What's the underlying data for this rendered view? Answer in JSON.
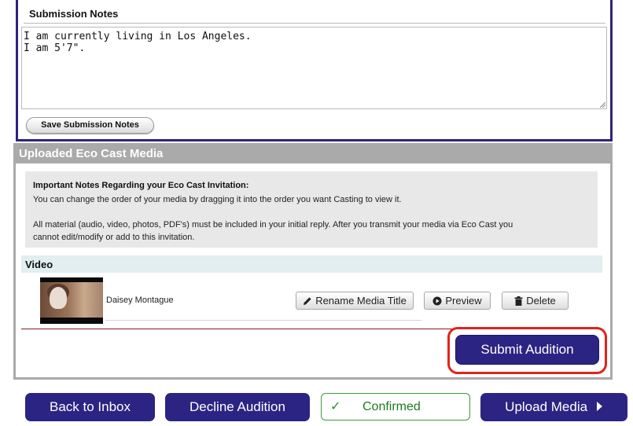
{
  "notes": {
    "title": "Submission Notes",
    "value": "I am currently living in Los Angeles.\nI am 5'7\".",
    "save_label": "Save Submission Notes"
  },
  "media": {
    "section_title": "Uploaded Eco Cast Media",
    "important_heading": "Important Notes Regarding your Eco Cast Invitation:",
    "important_lines": [
      "You can change the order of your media by dragging it into the order you want Casting to view it.",
      "All material (audio, video, photos, PDF's) must be included in your initial reply. After you transmit your media via Eco Cast you",
      "cannot edit/modify or add to this invitation."
    ],
    "video_label": "Video",
    "items": [
      {
        "name": "Daisey Montague",
        "rename_label": "Rename Media Title",
        "preview_label": "Preview",
        "delete_label": "Delete"
      }
    ],
    "submit_label": "Submit Audition"
  },
  "footer": {
    "back_label": "Back to Inbox",
    "decline_label": "Decline Audition",
    "confirmed_label": "Confirmed",
    "upload_label": "Upload Media"
  },
  "colors": {
    "primary": "#2c2483",
    "highlight_ring": "#e2231a",
    "confirmed": "#2b8a2b",
    "section_bar": "#aaaaaa"
  },
  "icons": [
    "pencil-icon",
    "play-circle-icon",
    "trash-icon",
    "check-icon",
    "arrow-right-icon",
    "resize-grip-icon"
  ]
}
